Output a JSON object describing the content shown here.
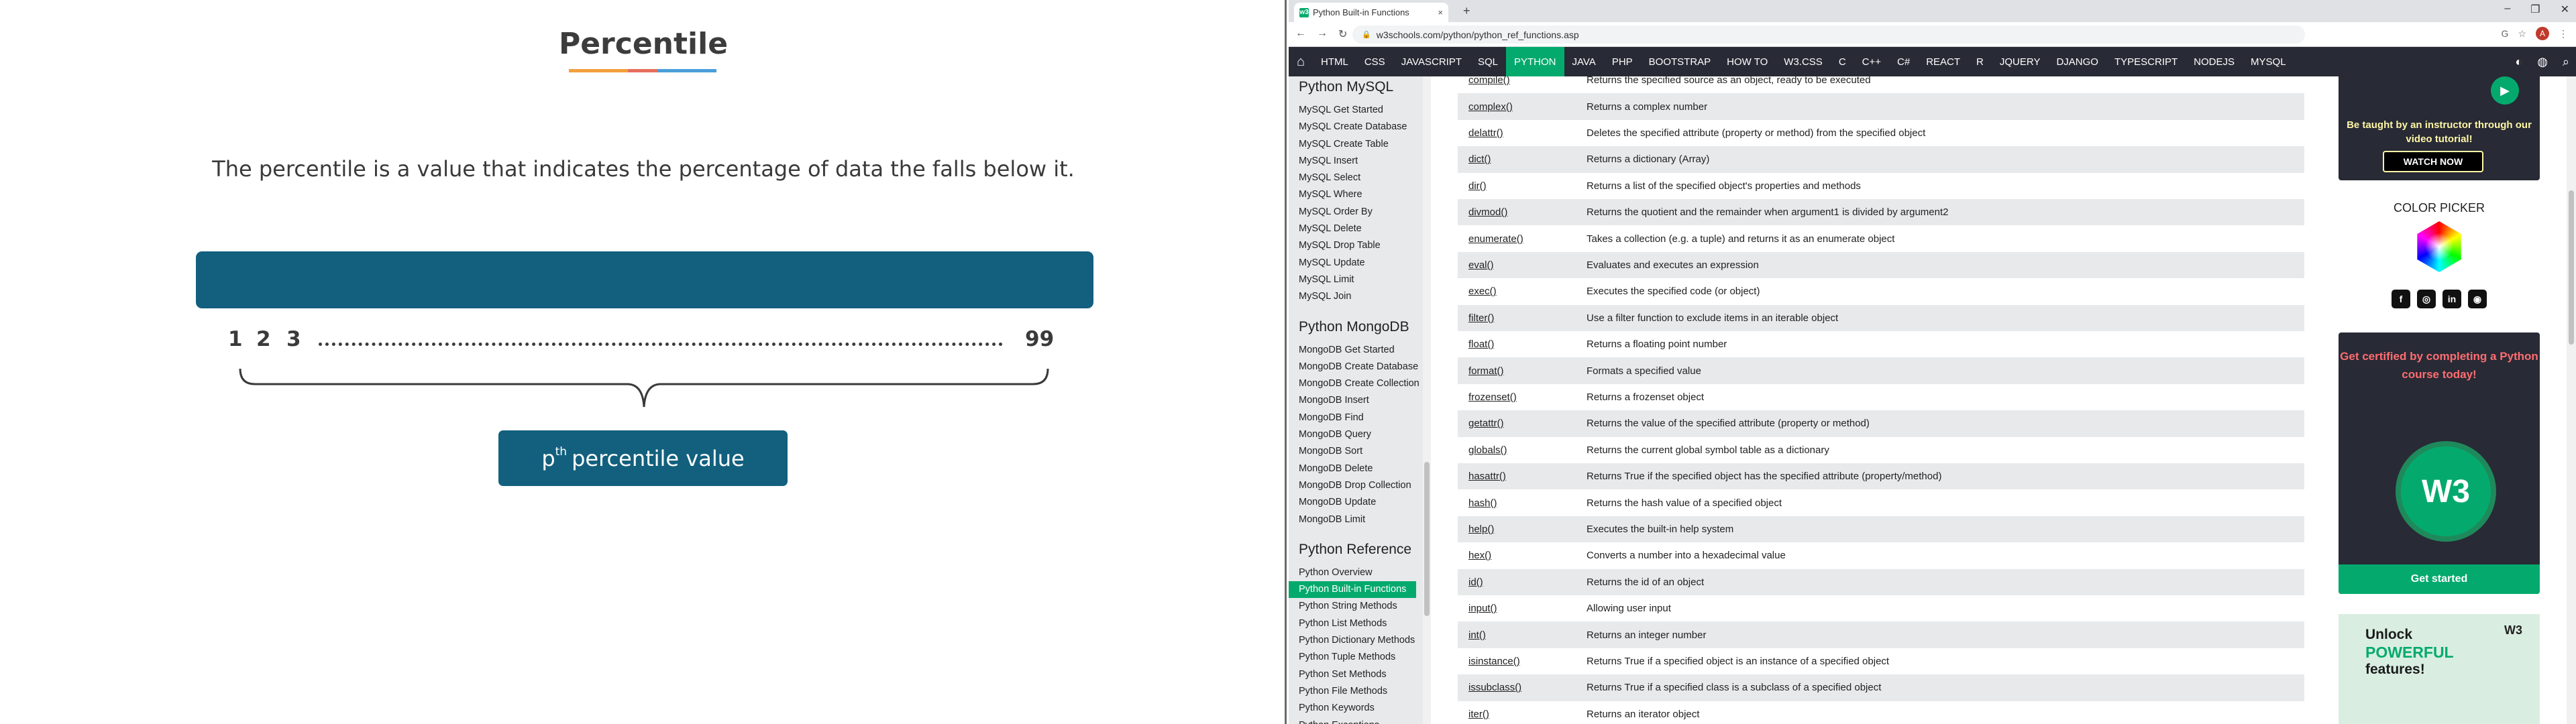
{
  "left": {
    "title": "Percentile",
    "title_colors": [
      "#f2a03d",
      "#f2a03d",
      "#e66e5d",
      "#4a9fd9",
      "#4a9fd9"
    ],
    "description": "The percentile is a value that indicates the percentage of data the falls below it.",
    "numbers": [
      "1",
      "2",
      "3",
      "99"
    ],
    "pbox": {
      "base": "p",
      "sup": "th",
      "text": "percentile value"
    }
  },
  "browser": {
    "tab_title": "Python Built-in Functions",
    "tab_favicon": "w3",
    "tab_close": "×",
    "new_tab": "+",
    "window_controls": [
      "–",
      "❐",
      "✕"
    ],
    "nav_buttons": [
      "←",
      "→",
      "↻"
    ],
    "url": "w3schools.com/python/python_ref_functions.asp",
    "extension_icons": [
      "G",
      "☆",
      "⋮"
    ],
    "avatar": "A"
  },
  "topnav": {
    "home_icon": "⌂",
    "items": [
      {
        "label": "HTML",
        "active": false
      },
      {
        "label": "CSS",
        "active": false
      },
      {
        "label": "JAVASCRIPT",
        "active": false
      },
      {
        "label": "SQL",
        "active": false
      },
      {
        "label": "PYTHON",
        "active": true
      },
      {
        "label": "JAVA",
        "active": false
      },
      {
        "label": "PHP",
        "active": false
      },
      {
        "label": "BOOTSTRAP",
        "active": false
      },
      {
        "label": "HOW TO",
        "active": false
      },
      {
        "label": "W3.CSS",
        "active": false
      },
      {
        "label": "C",
        "active": false
      },
      {
        "label": "C++",
        "active": false
      },
      {
        "label": "C#",
        "active": false
      },
      {
        "label": "REACT",
        "active": false
      },
      {
        "label": "R",
        "active": false
      },
      {
        "label": "JQUERY",
        "active": false
      },
      {
        "label": "DJANGO",
        "active": false
      },
      {
        "label": "TYPESCRIPT",
        "active": false
      },
      {
        "label": "NODEJS",
        "active": false
      },
      {
        "label": "MYSQL",
        "active": false
      }
    ],
    "right_icons": [
      "◐",
      "◍",
      "⌕"
    ]
  },
  "sidebar": {
    "sections": [
      {
        "heading": "Python MySQL",
        "items": [
          "MySQL Get Started",
          "MySQL Create Database",
          "MySQL Create Table",
          "MySQL Insert",
          "MySQL Select",
          "MySQL Where",
          "MySQL Order By",
          "MySQL Delete",
          "MySQL Drop Table",
          "MySQL Update",
          "MySQL Limit",
          "MySQL Join"
        ]
      },
      {
        "heading": "Python MongoDB",
        "items": [
          "MongoDB Get Started",
          "MongoDB Create Database",
          "MongoDB Create Collection",
          "MongoDB Insert",
          "MongoDB Find",
          "MongoDB Query",
          "MongoDB Sort",
          "MongoDB Delete",
          "MongoDB Drop Collection",
          "MongoDB Update",
          "MongoDB Limit"
        ]
      },
      {
        "heading": "Python Reference",
        "items": [
          "Python Overview",
          "Python Built-in Functions",
          "Python String Methods",
          "Python List Methods",
          "Python Dictionary Methods",
          "Python Tuple Methods",
          "Python Set Methods",
          "Python File Methods",
          "Python Keywords",
          "Python Exceptions"
        ]
      }
    ],
    "active_item": "Python Built-in Functions"
  },
  "functions": [
    {
      "name": "compile()",
      "desc": "Returns the specified source as an object, ready to be executed"
    },
    {
      "name": "complex()",
      "desc": "Returns a complex number"
    },
    {
      "name": "delattr()",
      "desc": "Deletes the specified attribute (property or method) from the specified object"
    },
    {
      "name": "dict()",
      "desc": "Returns a dictionary (Array)"
    },
    {
      "name": "dir()",
      "desc": "Returns a list of the specified object's properties and methods"
    },
    {
      "name": "divmod()",
      "desc": "Returns the quotient and the remainder when argument1 is divided by argument2"
    },
    {
      "name": "enumerate()",
      "desc": "Takes a collection (e.g. a tuple) and returns it as an enumerate object"
    },
    {
      "name": "eval()",
      "desc": "Evaluates and executes an expression"
    },
    {
      "name": "exec()",
      "desc": "Executes the specified code (or object)"
    },
    {
      "name": "filter()",
      "desc": "Use a filter function to exclude items in an iterable object"
    },
    {
      "name": "float()",
      "desc": "Returns a floating point number"
    },
    {
      "name": "format()",
      "desc": "Formats a specified value"
    },
    {
      "name": "frozenset()",
      "desc": "Returns a frozenset object"
    },
    {
      "name": "getattr()",
      "desc": "Returns the value of the specified attribute (property or method)"
    },
    {
      "name": "globals()",
      "desc": "Returns the current global symbol table as a dictionary"
    },
    {
      "name": "hasattr()",
      "desc": "Returns True if the specified object has the specified attribute (property/method)"
    },
    {
      "name": "hash()",
      "desc": "Returns the hash value of a specified object"
    },
    {
      "name": "help()",
      "desc": "Executes the built-in help system"
    },
    {
      "name": "hex()",
      "desc": "Converts a number into a hexadecimal value"
    },
    {
      "name": "id()",
      "desc": "Returns the id of an object"
    },
    {
      "name": "input()",
      "desc": "Allowing user input"
    },
    {
      "name": "int()",
      "desc": "Returns an integer number"
    },
    {
      "name": "isinstance()",
      "desc": "Returns True if a specified object is an instance of a specified object"
    },
    {
      "name": "issubclass()",
      "desc": "Returns True if a specified class is a subclass of a specified object"
    },
    {
      "name": "iter()",
      "desc": "Returns an iterator object"
    }
  ],
  "ads": {
    "play_icon": "▶",
    "video_text": "Be taught by an instructor through our video tutorial!",
    "watch_now": "WATCH NOW",
    "color_picker": "COLOR PICKER",
    "social_icons": [
      "f",
      "◎",
      "in",
      "◉"
    ],
    "cert_text": "Get certified by completing a Python course today!",
    "badge": "W3",
    "get_started": "Get started",
    "unlock_line1": "Unlock",
    "unlock_line2": "POWERFUL",
    "unlock_line3": "features!",
    "unlock_logo": "W3"
  },
  "colors": {
    "accent": "#04aa6d",
    "nav_bg": "#282a35",
    "slide_blue": "#12607e"
  }
}
